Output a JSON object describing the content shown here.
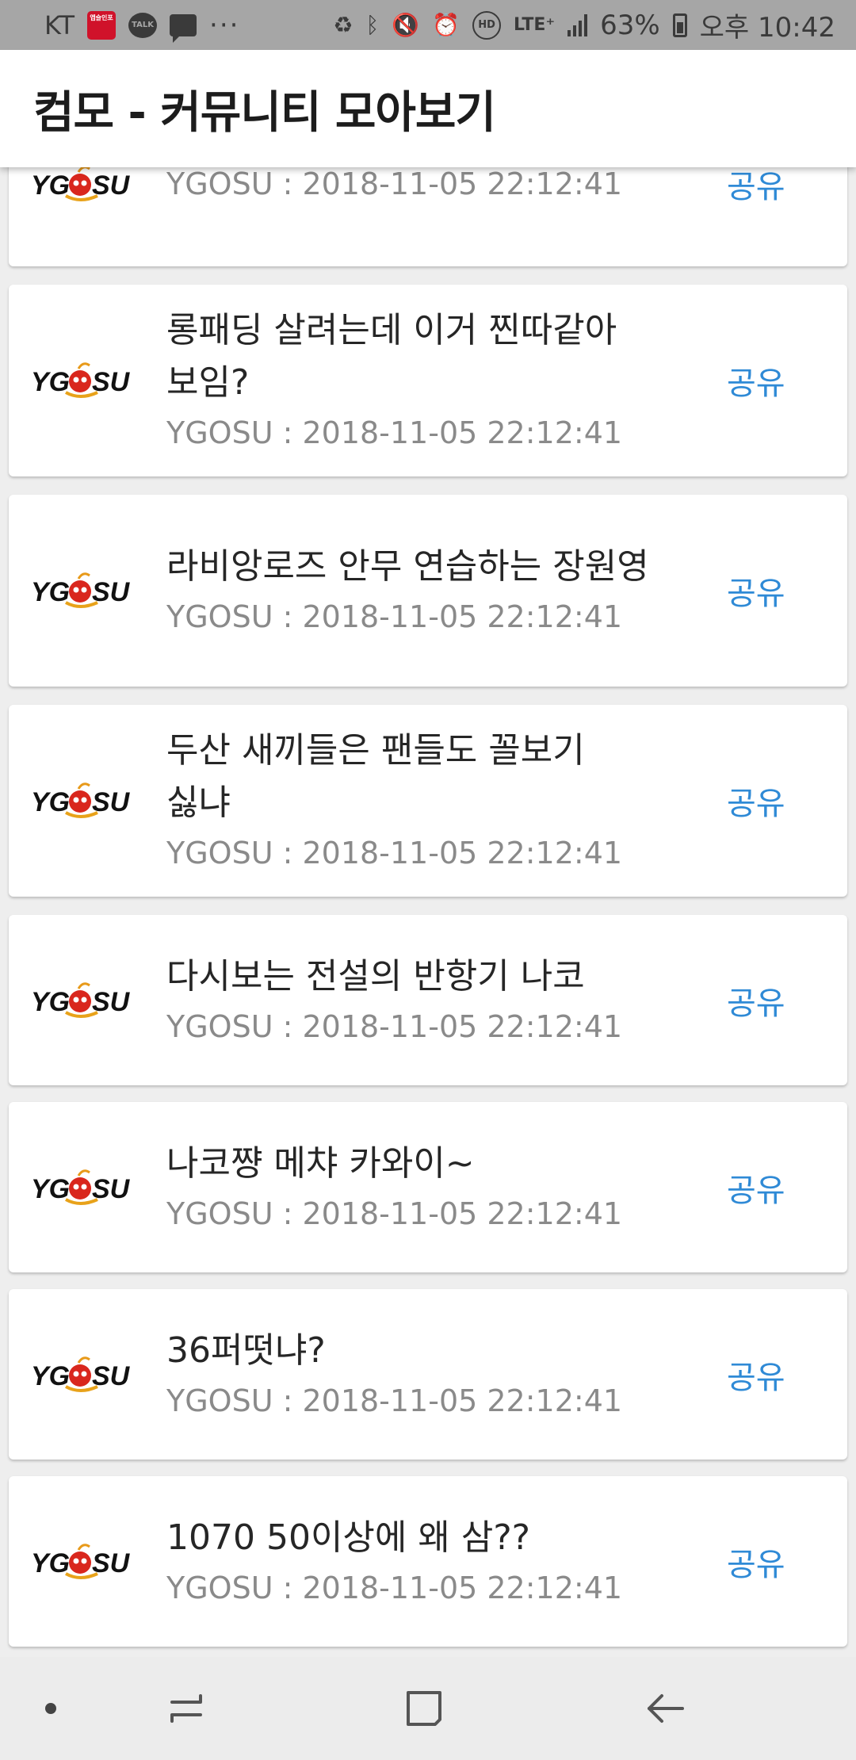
{
  "status_bar": {
    "carrier": "KT",
    "red_icon_text": "앱슬인포",
    "talk_label": "TALK",
    "more": "···",
    "lte": "LTE⁺",
    "battery": "63%",
    "time": "오후 10:42"
  },
  "app_bar": {
    "title": "컴모 - 커뮤니티 모아보기"
  },
  "posts": [
    {
      "title": "",
      "meta": "YGOSU : 2018-11-05 22:12:41",
      "share": "공유"
    },
    {
      "title": "롱패딩 살려는데 이거 찐따같아 보임?",
      "meta": "YGOSU : 2018-11-05 22:12:41",
      "share": "공유"
    },
    {
      "title": "라비앙로즈 안무 연습하는 장원영",
      "meta": "YGOSU : 2018-11-05 22:12:41",
      "share": "공유"
    },
    {
      "title": "두산 새끼들은 팬들도 꼴보기 싫냐",
      "meta": "YGOSU : 2018-11-05 22:12:41",
      "share": "공유"
    },
    {
      "title": "다시보는 전설의 반항기 나코",
      "meta": "YGOSU : 2018-11-05 22:12:41",
      "share": "공유"
    },
    {
      "title": "나코쨩 메챠 카와이~",
      "meta": "YGOSU : 2018-11-05 22:12:41",
      "share": "공유"
    },
    {
      "title": "36퍼떳냐?",
      "meta": "YGOSU : 2018-11-05 22:12:41",
      "share": "공유"
    },
    {
      "title": "1070 50이상에 왜 삼??",
      "meta": "YGOSU : 2018-11-05 22:12:41",
      "share": "공유"
    }
  ],
  "logo_text": {
    "left": "YG",
    "right": "SU"
  },
  "colors": {
    "share": "#2f8ad6",
    "meta": "#8a8a8a",
    "status_bar": "#a6a6a6",
    "nav_bar": "#ececec"
  },
  "nav_bar": {
    "icons": [
      "dot-icon",
      "recent-apps-icon",
      "home-icon",
      "back-icon"
    ]
  }
}
